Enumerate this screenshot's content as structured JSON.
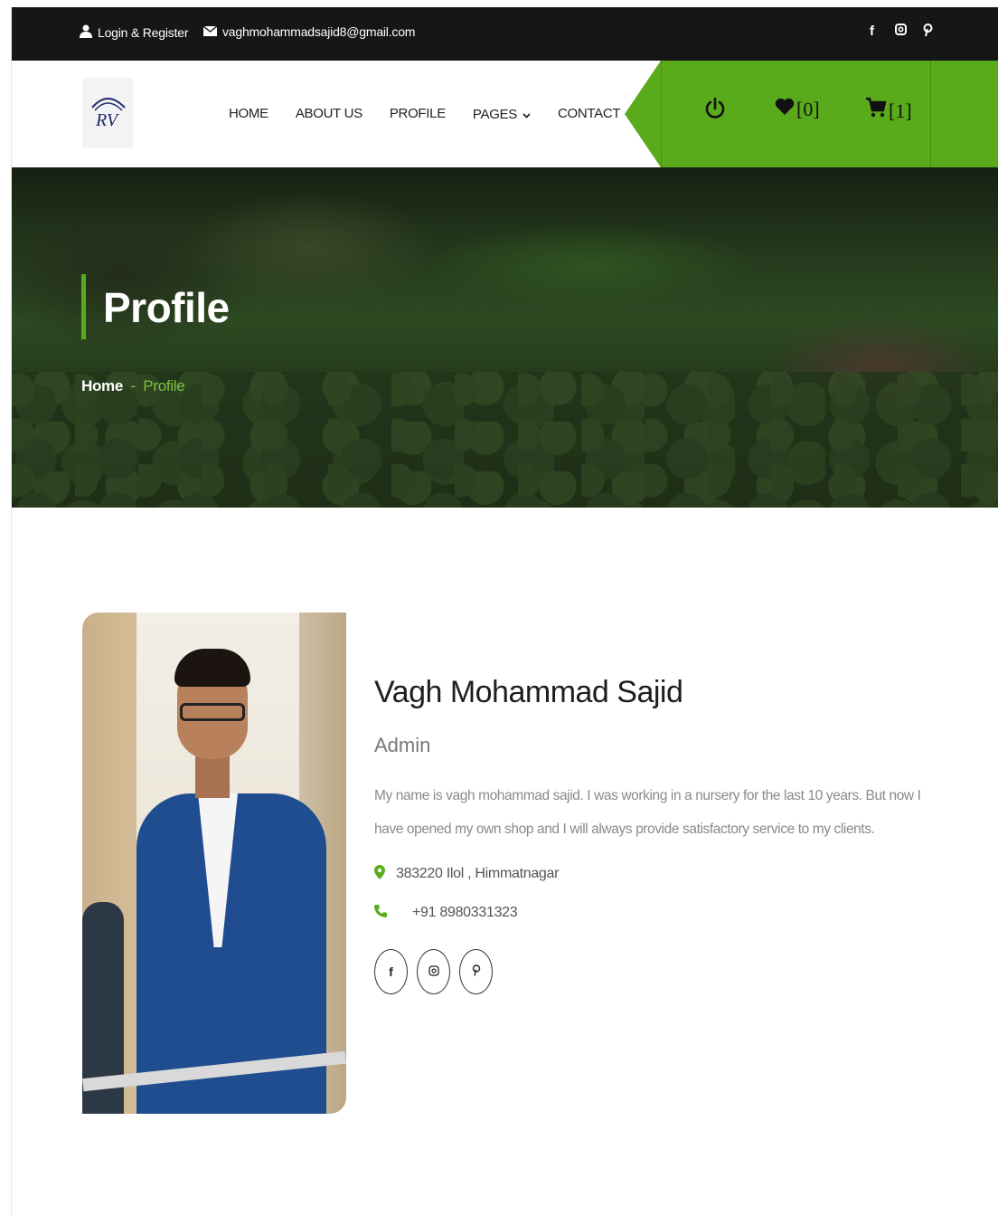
{
  "topbar": {
    "login_label": "Login & Register",
    "email": "vaghmohammadsajid8@gmail.com",
    "social_icons": [
      "facebook-icon",
      "instagram-icon",
      "pinterest-icon"
    ]
  },
  "logo": {
    "text": "RV"
  },
  "nav": {
    "items": [
      {
        "label": "HOME"
      },
      {
        "label": "ABOUT US"
      },
      {
        "label": "PROFILE"
      },
      {
        "label": "PAGES"
      },
      {
        "label": "CONTACT"
      }
    ],
    "wishlist_count": "[0]",
    "cart_count": "[1]",
    "accent_color": "#5aab1c"
  },
  "banner": {
    "title": "Profile",
    "breadcrumb_home": "Home",
    "breadcrumb_sep": "-",
    "breadcrumb_current": "Profile"
  },
  "profile": {
    "name": "Vagh Mohammad Sajid",
    "role": "Admin",
    "bio": "My name is vagh mohammad sajid. I was working in a nursery for the last 10 years. But now I have opened my own shop and I will always provide satisfactory service to my clients.",
    "address": "383220 Ilol , Himmatnagar",
    "phone": "+91 8980331323",
    "social_icons": [
      "facebook-icon",
      "instagram-icon",
      "pinterest-icon"
    ]
  }
}
